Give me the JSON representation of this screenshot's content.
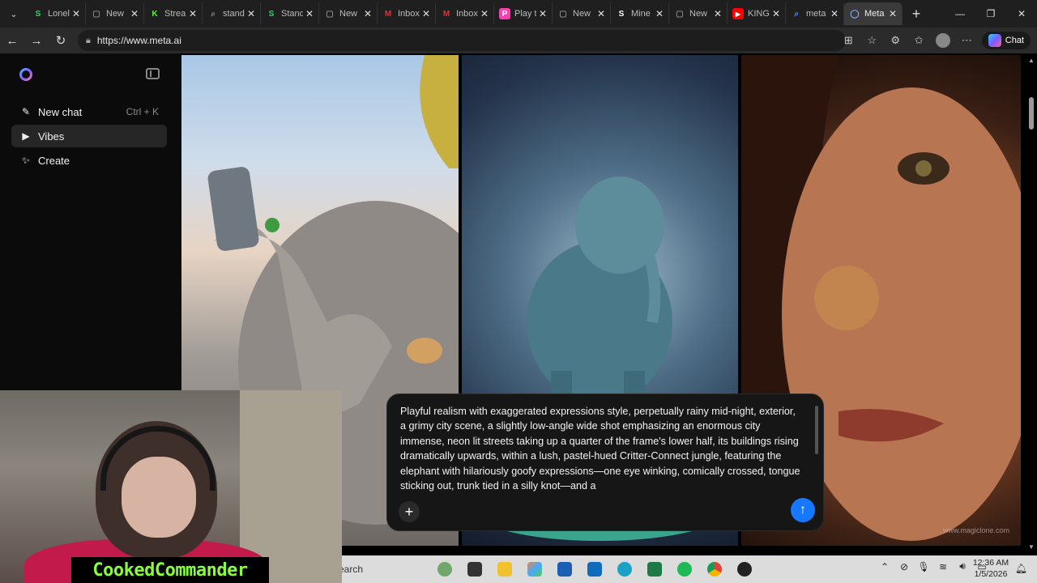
{
  "browser": {
    "tabs": [
      {
        "title": "Lonel",
        "icon": "S",
        "color": "#2fd463",
        "active": false
      },
      {
        "title": "New",
        "icon": "doc",
        "color": "#888",
        "active": false
      },
      {
        "title": "Strea",
        "icon": "K",
        "color": "#53fc18",
        "active": false
      },
      {
        "title": "stand",
        "icon": "search",
        "color": "#888",
        "active": false
      },
      {
        "title": "Stand",
        "icon": "S",
        "color": "#2fd463",
        "active": false
      },
      {
        "title": "New",
        "icon": "doc",
        "color": "#888",
        "active": false
      },
      {
        "title": "Inbox",
        "icon": "M",
        "color": "#d33",
        "active": false
      },
      {
        "title": "Inbox",
        "icon": "M",
        "color": "#d33",
        "active": false
      },
      {
        "title": "Play t",
        "icon": "P",
        "color": "#ff3fb0",
        "active": false
      },
      {
        "title": "New",
        "icon": "doc",
        "color": "#888",
        "active": false
      },
      {
        "title": "Mine",
        "icon": "S",
        "color": "#fff",
        "active": false
      },
      {
        "title": "New",
        "icon": "doc",
        "color": "#888",
        "active": false
      },
      {
        "title": "KING",
        "icon": "yt",
        "color": "#f00",
        "active": false
      },
      {
        "title": "meta",
        "icon": "search",
        "color": "#4a8df8",
        "active": false
      },
      {
        "title": "Meta",
        "icon": "meta",
        "color": "#7fb0ff",
        "active": true
      }
    ],
    "url": "https://www.meta.ai",
    "chat_label": "Chat"
  },
  "sidebar": {
    "items": [
      {
        "label": "New chat",
        "shortcut": "Ctrl + K",
        "icon": "edit-icon"
      },
      {
        "label": "Vibes",
        "shortcut": "",
        "icon": "play-icon"
      },
      {
        "label": "Create",
        "shortcut": "",
        "icon": "sparkle-icon"
      }
    ]
  },
  "composer": {
    "prompt": "Playful realism with exaggerated expressions style, perpetually rainy mid-night, exterior, a grimy city scene, a slightly low-angle wide shot emphasizing an enormous city immense, neon lit streets taking up a quarter of the frame's lower half, its buildings rising dramatically upwards, within a lush, pastel-hued Critter-Connect jungle, featuring the elephant with hilariously goofy expressions—one eye winking, comically crossed, tongue sticking out, trunk tied in a silly knot—and a"
  },
  "gallery": {
    "watermark": "www.magiclone.com"
  },
  "taskbar": {
    "search_label": "earch",
    "time": "12:36 AM",
    "date": "1/5/2026"
  },
  "webcam": {
    "name": "CookedCommander"
  }
}
